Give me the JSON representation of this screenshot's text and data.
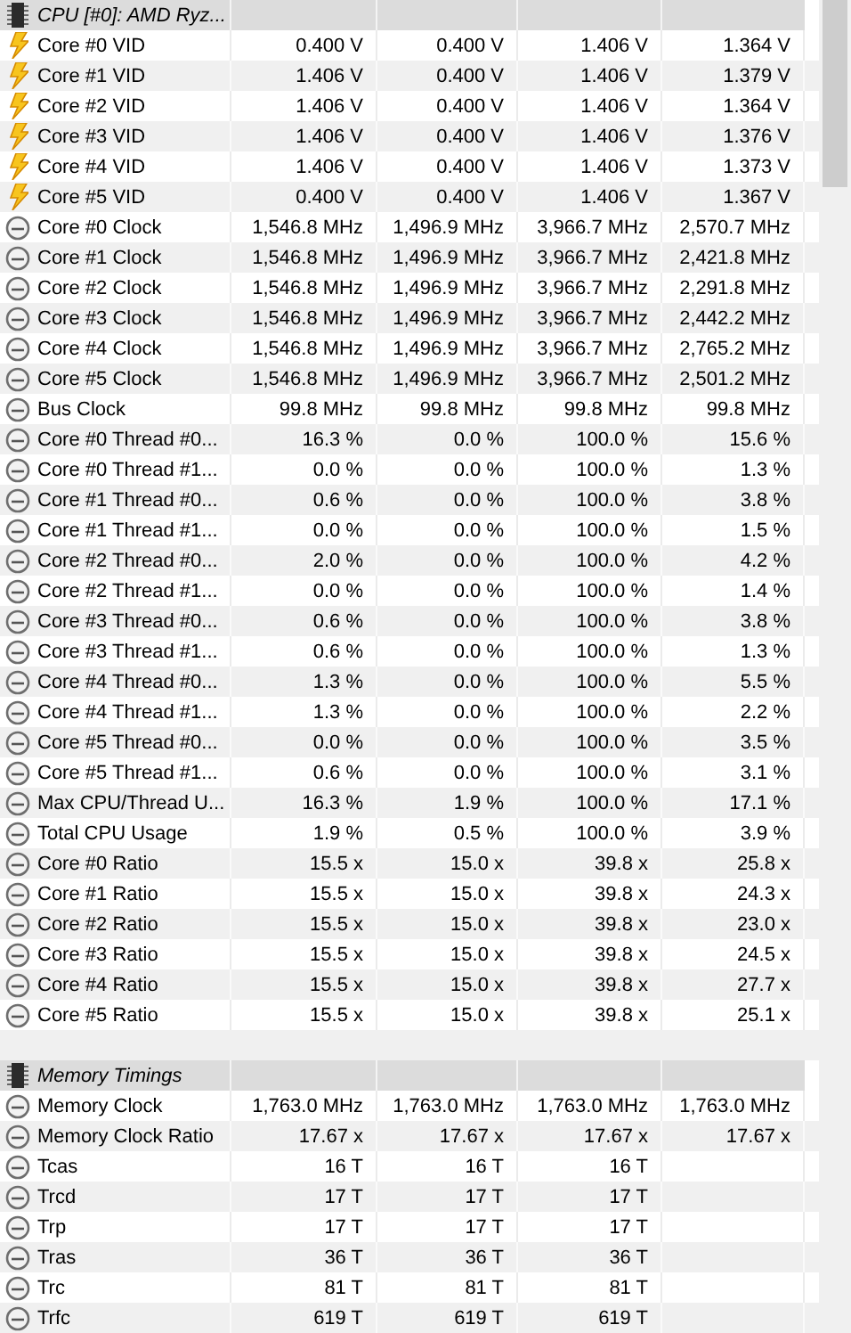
{
  "sections": [
    {
      "title": "CPU [#0]: AMD Ryz...",
      "rows": [
        {
          "kind": "voltage",
          "label": "Core #0 VID",
          "values": [
            "0.400 V",
            "0.400 V",
            "1.406 V",
            "1.364 V"
          ]
        },
        {
          "kind": "voltage",
          "label": "Core #1 VID",
          "values": [
            "1.406 V",
            "0.400 V",
            "1.406 V",
            "1.379 V"
          ]
        },
        {
          "kind": "voltage",
          "label": "Core #2 VID",
          "values": [
            "1.406 V",
            "0.400 V",
            "1.406 V",
            "1.364 V"
          ]
        },
        {
          "kind": "voltage",
          "label": "Core #3 VID",
          "values": [
            "1.406 V",
            "0.400 V",
            "1.406 V",
            "1.376 V"
          ]
        },
        {
          "kind": "voltage",
          "label": "Core #4 VID",
          "values": [
            "1.406 V",
            "0.400 V",
            "1.406 V",
            "1.373 V"
          ]
        },
        {
          "kind": "voltage",
          "label": "Core #5 VID",
          "values": [
            "0.400 V",
            "0.400 V",
            "1.406 V",
            "1.367 V"
          ]
        },
        {
          "kind": "clock",
          "label": "Core #0 Clock",
          "values": [
            "1,546.8 MHz",
            "1,496.9 MHz",
            "3,966.7 MHz",
            "2,570.7 MHz"
          ]
        },
        {
          "kind": "clock",
          "label": "Core #1 Clock",
          "values": [
            "1,546.8 MHz",
            "1,496.9 MHz",
            "3,966.7 MHz",
            "2,421.8 MHz"
          ]
        },
        {
          "kind": "clock",
          "label": "Core #2 Clock",
          "values": [
            "1,546.8 MHz",
            "1,496.9 MHz",
            "3,966.7 MHz",
            "2,291.8 MHz"
          ]
        },
        {
          "kind": "clock",
          "label": "Core #3 Clock",
          "values": [
            "1,546.8 MHz",
            "1,496.9 MHz",
            "3,966.7 MHz",
            "2,442.2 MHz"
          ]
        },
        {
          "kind": "clock",
          "label": "Core #4 Clock",
          "values": [
            "1,546.8 MHz",
            "1,496.9 MHz",
            "3,966.7 MHz",
            "2,765.2 MHz"
          ]
        },
        {
          "kind": "clock",
          "label": "Core #5 Clock",
          "values": [
            "1,546.8 MHz",
            "1,496.9 MHz",
            "3,966.7 MHz",
            "2,501.2 MHz"
          ]
        },
        {
          "kind": "clock",
          "label": "Bus Clock",
          "values": [
            "99.8 MHz",
            "99.8 MHz",
            "99.8 MHz",
            "99.8 MHz"
          ]
        },
        {
          "kind": "clock",
          "label": "Core #0 Thread #0...",
          "values": [
            "16.3 %",
            "0.0 %",
            "100.0 %",
            "15.6 %"
          ]
        },
        {
          "kind": "clock",
          "label": "Core #0 Thread #1...",
          "values": [
            "0.0 %",
            "0.0 %",
            "100.0 %",
            "1.3 %"
          ]
        },
        {
          "kind": "clock",
          "label": "Core #1 Thread #0...",
          "values": [
            "0.6 %",
            "0.0 %",
            "100.0 %",
            "3.8 %"
          ]
        },
        {
          "kind": "clock",
          "label": "Core #1 Thread #1...",
          "values": [
            "0.0 %",
            "0.0 %",
            "100.0 %",
            "1.5 %"
          ]
        },
        {
          "kind": "clock",
          "label": "Core #2 Thread #0...",
          "values": [
            "2.0 %",
            "0.0 %",
            "100.0 %",
            "4.2 %"
          ]
        },
        {
          "kind": "clock",
          "label": "Core #2 Thread #1...",
          "values": [
            "0.0 %",
            "0.0 %",
            "100.0 %",
            "1.4 %"
          ]
        },
        {
          "kind": "clock",
          "label": "Core #3 Thread #0...",
          "values": [
            "0.6 %",
            "0.0 %",
            "100.0 %",
            "3.8 %"
          ]
        },
        {
          "kind": "clock",
          "label": "Core #3 Thread #1...",
          "values": [
            "0.6 %",
            "0.0 %",
            "100.0 %",
            "1.3 %"
          ]
        },
        {
          "kind": "clock",
          "label": "Core #4 Thread #0...",
          "values": [
            "1.3 %",
            "0.0 %",
            "100.0 %",
            "5.5 %"
          ]
        },
        {
          "kind": "clock",
          "label": "Core #4 Thread #1...",
          "values": [
            "1.3 %",
            "0.0 %",
            "100.0 %",
            "2.2 %"
          ]
        },
        {
          "kind": "clock",
          "label": "Core #5 Thread #0...",
          "values": [
            "0.0 %",
            "0.0 %",
            "100.0 %",
            "3.5 %"
          ]
        },
        {
          "kind": "clock",
          "label": "Core #5 Thread #1...",
          "values": [
            "0.6 %",
            "0.0 %",
            "100.0 %",
            "3.1 %"
          ]
        },
        {
          "kind": "clock",
          "label": "Max CPU/Thread U...",
          "values": [
            "16.3 %",
            "1.9 %",
            "100.0 %",
            "17.1 %"
          ]
        },
        {
          "kind": "clock",
          "label": "Total CPU Usage",
          "values": [
            "1.9 %",
            "0.5 %",
            "100.0 %",
            "3.9 %"
          ]
        },
        {
          "kind": "clock",
          "label": "Core #0 Ratio",
          "values": [
            "15.5 x",
            "15.0 x",
            "39.8 x",
            "25.8 x"
          ]
        },
        {
          "kind": "clock",
          "label": "Core #1 Ratio",
          "values": [
            "15.5 x",
            "15.0 x",
            "39.8 x",
            "24.3 x"
          ]
        },
        {
          "kind": "clock",
          "label": "Core #2 Ratio",
          "values": [
            "15.5 x",
            "15.0 x",
            "39.8 x",
            "23.0 x"
          ]
        },
        {
          "kind": "clock",
          "label": "Core #3 Ratio",
          "values": [
            "15.5 x",
            "15.0 x",
            "39.8 x",
            "24.5 x"
          ]
        },
        {
          "kind": "clock",
          "label": "Core #4 Ratio",
          "values": [
            "15.5 x",
            "15.0 x",
            "39.8 x",
            "27.7 x"
          ]
        },
        {
          "kind": "clock",
          "label": "Core #5 Ratio",
          "values": [
            "15.5 x",
            "15.0 x",
            "39.8 x",
            "25.1 x"
          ]
        }
      ]
    },
    {
      "title": "Memory Timings",
      "rows": [
        {
          "kind": "clock",
          "label": "Memory Clock",
          "values": [
            "1,763.0 MHz",
            "1,763.0 MHz",
            "1,763.0 MHz",
            "1,763.0 MHz"
          ]
        },
        {
          "kind": "clock",
          "label": "Memory Clock Ratio",
          "values": [
            "17.67 x",
            "17.67 x",
            "17.67 x",
            "17.67 x"
          ]
        },
        {
          "kind": "clock",
          "label": "Tcas",
          "values": [
            "16 T",
            "16 T",
            "16 T"
          ]
        },
        {
          "kind": "clock",
          "label": "Trcd",
          "values": [
            "17 T",
            "17 T",
            "17 T"
          ]
        },
        {
          "kind": "clock",
          "label": "Trp",
          "values": [
            "17 T",
            "17 T",
            "17 T"
          ]
        },
        {
          "kind": "clock",
          "label": "Tras",
          "values": [
            "36 T",
            "36 T",
            "36 T"
          ]
        },
        {
          "kind": "clock",
          "label": "Trc",
          "values": [
            "81 T",
            "81 T",
            "81 T"
          ]
        },
        {
          "kind": "clock",
          "label": "Trfc",
          "values": [
            "619 T",
            "619 T",
            "619 T"
          ]
        }
      ]
    }
  ]
}
